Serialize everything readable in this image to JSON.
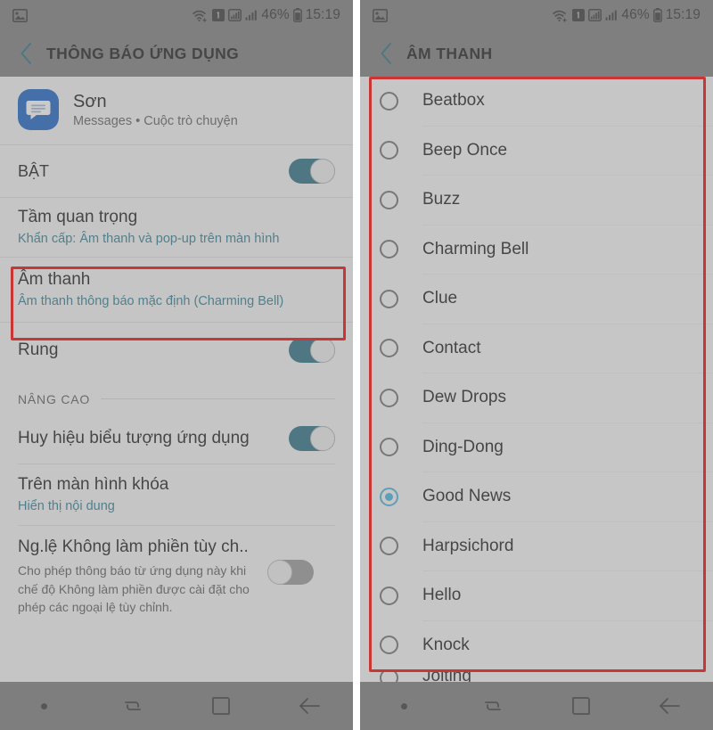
{
  "status_bar": {
    "gallery_icon": "image-icon",
    "wifi_icon": "wifi-icon",
    "sim_icon": "sim-1-icon",
    "signal_icon_1": "signal-bars-boxed-icon",
    "signal_icon_2": "signal-bars-icon",
    "battery_percent": "46%",
    "battery_icon": "battery-icon",
    "clock": "15:19"
  },
  "left_screen": {
    "appbar": {
      "back_icon": "chevron-left-icon",
      "title": "THÔNG BÁO ỨNG DỤNG"
    },
    "app_header": {
      "icon": "messages-app-icon",
      "name": "Sơn",
      "subtitle": "Messages • Cuộc trò chuyện"
    },
    "rows": [
      {
        "name": "enable-row",
        "title": "BẬT",
        "subtitle": "",
        "toggle": "on"
      },
      {
        "name": "importance-row",
        "title": "Tầm quan trọng",
        "subtitle": "Khẩn cấp: Âm thanh và pop-up trên màn hình",
        "toggle": "none"
      },
      {
        "name": "sound-row",
        "title": "Âm thanh",
        "subtitle": "Âm thanh thông báo mặc định (Charming Bell)",
        "toggle": "none",
        "highlighted": true
      },
      {
        "name": "vibrate-row",
        "title": "Rung",
        "subtitle": "",
        "toggle": "on"
      }
    ],
    "section_advanced": "NÂNG CAO",
    "advanced_rows": [
      {
        "name": "app-icon-badge-row",
        "title": "Huy hiệu biểu tượng ứng dụng",
        "subtitle": "",
        "toggle": "on"
      },
      {
        "name": "lock-screen-row",
        "title": "Trên màn hình khóa",
        "subtitle": "Hiển thị nội dung",
        "toggle": "none"
      },
      {
        "name": "dnd-exception-row",
        "title": "Ng.lệ Không làm phiền tùy ch..",
        "subtitle": "Cho phép thông báo từ ứng dụng này khi chế độ Không làm phiền được cài đặt cho phép các ngoại lệ tùy chỉnh.",
        "toggle": "off"
      }
    ]
  },
  "right_screen": {
    "appbar": {
      "back_icon": "chevron-left-icon",
      "title": "ÂM THANH"
    },
    "sounds": [
      {
        "label": "Beatbox",
        "selected": false
      },
      {
        "label": "Beep Once",
        "selected": false
      },
      {
        "label": "Buzz",
        "selected": false
      },
      {
        "label": "Charming Bell",
        "selected": false
      },
      {
        "label": "Clue",
        "selected": false
      },
      {
        "label": "Contact",
        "selected": false
      },
      {
        "label": "Dew Drops",
        "selected": false
      },
      {
        "label": "Ding-Dong",
        "selected": false
      },
      {
        "label": "Good News",
        "selected": true
      },
      {
        "label": "Harpsichord",
        "selected": false
      },
      {
        "label": "Hello",
        "selected": false
      },
      {
        "label": "Knock",
        "selected": false
      }
    ],
    "partial_item": {
      "label": "Jolting",
      "selected": false
    }
  },
  "nav_bar": {
    "items": [
      {
        "name": "nav-dot",
        "icon": "dot-icon"
      },
      {
        "name": "nav-recents",
        "icon": "recents-icon"
      },
      {
        "name": "nav-home",
        "icon": "home-square-icon"
      },
      {
        "name": "nav-back",
        "icon": "arrow-left-icon"
      }
    ]
  },
  "colors": {
    "accent_teal": "#2a7186",
    "accent_cyan": "#45b6e0",
    "highlight_red": "#ff0000",
    "app_icon_blue": "#1a63c4",
    "surface": "#f7f7f7",
    "nav_bg": "#7c7c7c"
  }
}
